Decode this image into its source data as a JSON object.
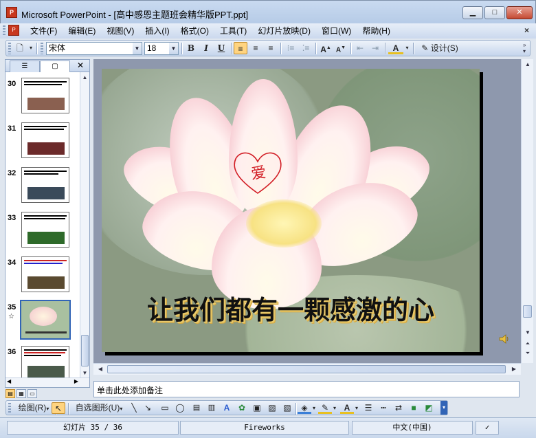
{
  "window": {
    "app_icon": "powerpoint-icon",
    "title": "Microsoft PowerPoint - [高中感恩主题班会精华版PPT.ppt]",
    "min_label": "▁",
    "max_label": "□",
    "close_label": "✕"
  },
  "menubar": {
    "items": [
      {
        "label": "文件(F)"
      },
      {
        "label": "编辑(E)"
      },
      {
        "label": "视图(V)"
      },
      {
        "label": "插入(I)"
      },
      {
        "label": "格式(O)"
      },
      {
        "label": "工具(T)"
      },
      {
        "label": "幻灯片放映(D)"
      },
      {
        "label": "窗口(W)"
      },
      {
        "label": "帮助(H)"
      }
    ],
    "close_label": "×"
  },
  "toolbar": {
    "font_name": "宋体",
    "font_size": "18",
    "bold": "B",
    "italic": "I",
    "underline": "U",
    "design_label": "设计(S)"
  },
  "slides_pane": {
    "thumbnails": [
      {
        "number": "30",
        "image_color": "#8a6050"
      },
      {
        "number": "31",
        "image_color": "#6b2a2a"
      },
      {
        "number": "32",
        "image_color": "#3a4a5a"
      },
      {
        "number": "33",
        "image_color": "#2e6a2a"
      },
      {
        "number": "34",
        "image_color": "#5a4a30"
      },
      {
        "number": "35",
        "image_color": "#a9c0a0",
        "selected": true,
        "mark": "☆"
      },
      {
        "number": "36",
        "image_color": "#4a5a4a"
      }
    ]
  },
  "slide": {
    "title": "让我们都有一颗感激的心",
    "heart_text": "爱",
    "background_color": "#8b9a82",
    "title_shadow_color": "#e8c96a"
  },
  "notes": {
    "placeholder": "单击此处添加备注"
  },
  "drawing_toolbar": {
    "draw_label": "绘图(R)",
    "autoshapes_label": "自选图形(U)"
  },
  "statusbar": {
    "slide_position": "幻灯片 35 / 36",
    "design_template": "Fireworks",
    "language": "中文(中国)"
  }
}
